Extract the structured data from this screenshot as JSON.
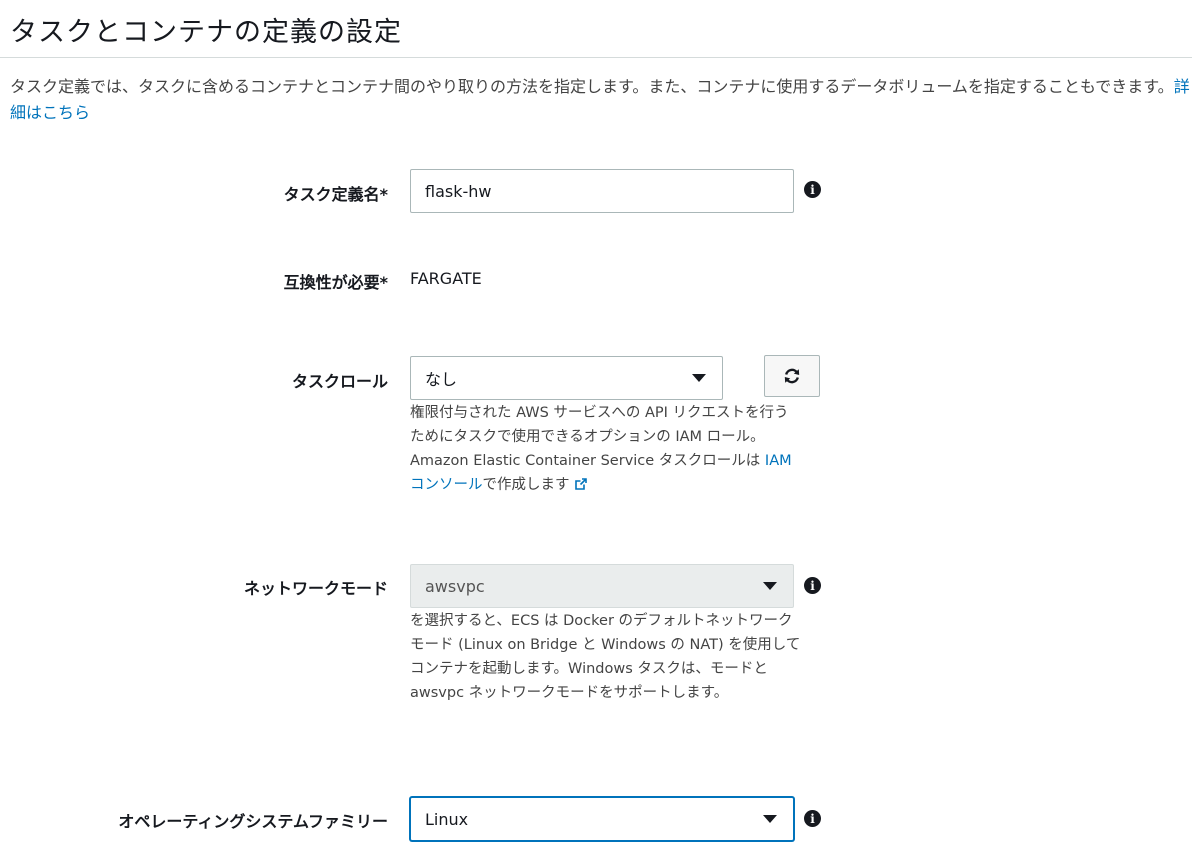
{
  "page": {
    "title": "タスクとコンテナの定義の設定",
    "description": "タスク定義では、タスクに含めるコンテナとコンテナ間のやり取りの方法を指定します。また、コンテナに使用するデータボリュームを指定することもできます。",
    "learn_more_link": "詳細はこちら"
  },
  "form": {
    "task_definition_name": {
      "label": "タスク定義名*",
      "value": "flask-hw"
    },
    "compatibility": {
      "label": "互換性が必要*",
      "value": "FARGATE"
    },
    "task_role": {
      "label": "タスクロール",
      "selected": "なし",
      "help_text": "権限付与された AWS サービスへの API リクエストを行うためにタスクで使用できるオプションの IAM ロール。Amazon Elastic Container Service タスクロールは ",
      "help_link": "IAM コンソール",
      "help_suffix": "で作成します"
    },
    "network_mode": {
      "label": "ネットワークモード",
      "selected": "awsvpc",
      "help_text": "を選択すると、ECS は Docker のデフォルトネットワークモード (Linux on Bridge と Windows の NAT) を使用してコンテナを起動します。Windows タスクは、モードと awsvpc ネットワークモードをサポートします。"
    },
    "os_family": {
      "label": "オペレーティングシステムファミリー",
      "selected": "Linux"
    }
  },
  "icons": {
    "info": "info-icon",
    "refresh": "refresh-icon",
    "external_link": "external-link-icon",
    "dropdown": "caret-down-icon"
  },
  "colors": {
    "link": "#0073bb",
    "focus_border": "#0073bb",
    "disabled_bg": "#eaeded"
  }
}
